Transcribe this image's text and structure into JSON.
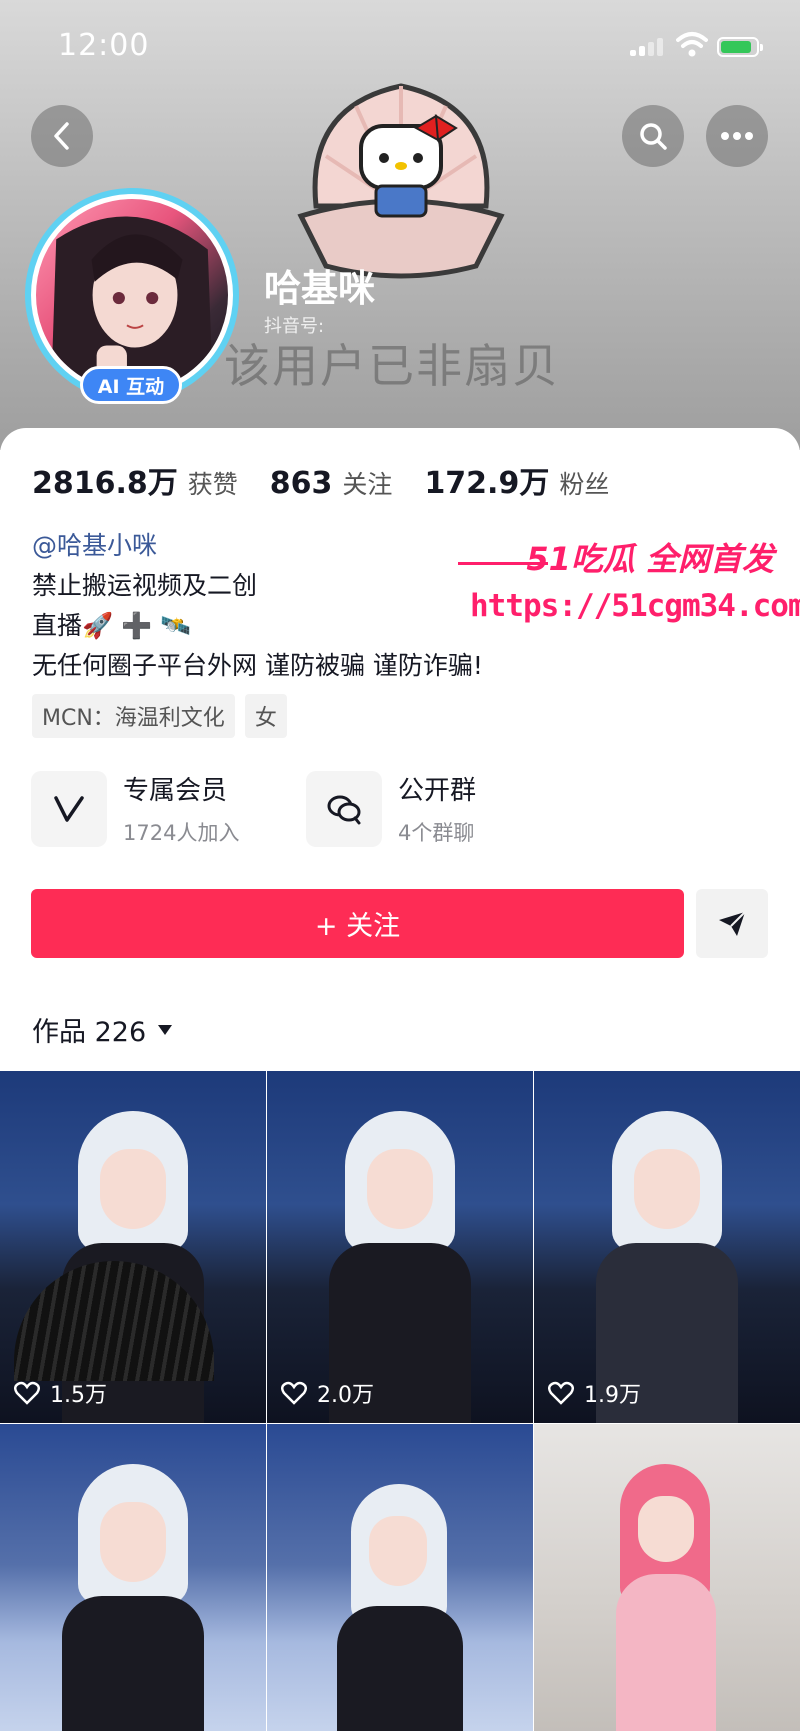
{
  "status_bar": {
    "time": "12:00"
  },
  "header": {
    "nickname": "哈基咪",
    "douyin_id_label": "抖音号:",
    "ghost_text": "该用户已非扇贝",
    "ai_badge": "AI 互动"
  },
  "stats": [
    {
      "value": "2816.8万",
      "label": "获赞"
    },
    {
      "value": "863",
      "label": "关注"
    },
    {
      "value": "172.9万",
      "label": "粉丝"
    }
  ],
  "bio": {
    "handle": "@哈基小咪",
    "lines": [
      "禁止搬运视频及二创",
      "直播🚀 ➕ 🛰️",
      "无任何圈子平台外网 谨防被骗 谨防诈骗!"
    ],
    "tags": [
      "MCN：海温利文化",
      "女"
    ]
  },
  "watermark": {
    "top": "51吃瓜 全网首发",
    "url": "https://51cgm34.com"
  },
  "features": [
    {
      "title": "专属会员",
      "subtitle": "1724人加入",
      "icon": "v-member-icon"
    },
    {
      "title": "公开群",
      "subtitle": "4个群聊",
      "icon": "group-chat-icon"
    }
  ],
  "actions": {
    "follow_label": "+ 关注"
  },
  "works": {
    "title": "作品 226",
    "items": [
      {
        "likes": "1.5万"
      },
      {
        "likes": "2.0万"
      },
      {
        "likes": "1.9万"
      },
      {
        "likes": ""
      },
      {
        "likes": ""
      },
      {
        "likes": ""
      }
    ]
  },
  "colors": {
    "accent": "#fe2c55",
    "badge": "#3e86f5",
    "watermark": "#ff1f6b"
  }
}
